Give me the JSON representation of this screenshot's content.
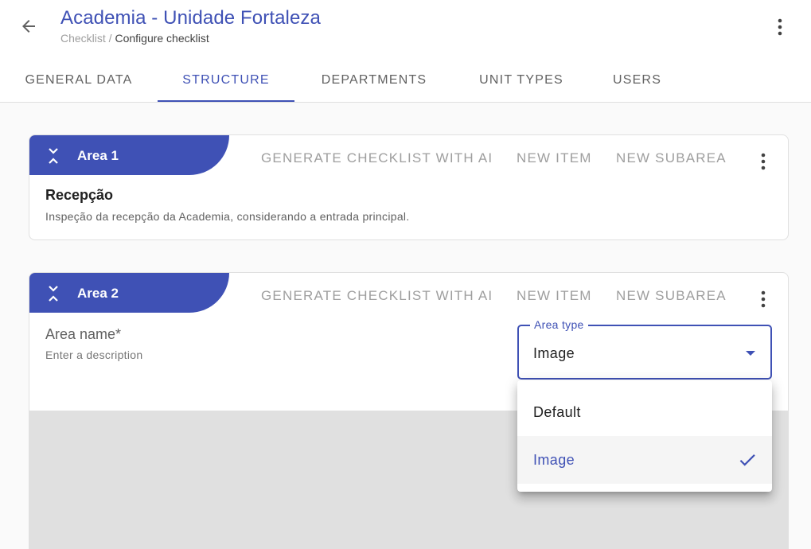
{
  "header": {
    "title": "Academia - Unidade Fortaleza",
    "breadcrumb_parent": "Checklist",
    "breadcrumb_separator": " / ",
    "breadcrumb_current": "Configure checklist",
    "back_icon": "arrow-left-icon",
    "menu_icon": "more-vert-icon"
  },
  "tabs": [
    {
      "label": "GENERAL DATA",
      "active": false
    },
    {
      "label": "STRUCTURE",
      "active": true
    },
    {
      "label": "DEPARTMENTS",
      "active": false
    },
    {
      "label": "UNIT TYPES",
      "active": false
    },
    {
      "label": "USERS",
      "active": false
    }
  ],
  "areas": [
    {
      "badge": "Area 1",
      "actions": {
        "generate": "GENERATE CHECKLIST WITH AI",
        "new_item": "NEW ITEM",
        "new_subarea": "NEW SUBAREA"
      },
      "name": "Recepção",
      "description": "Inspeção da recepção da Academia, considerando a entrada principal."
    },
    {
      "badge": "Area 2",
      "actions": {
        "generate": "GENERATE CHECKLIST WITH AI",
        "new_item": "NEW ITEM",
        "new_subarea": "NEW SUBAREA"
      },
      "name_placeholder": "Area name*",
      "description_placeholder": "Enter a description",
      "area_type": {
        "label": "Area type",
        "value": "Image",
        "options": [
          {
            "label": "Default",
            "selected": false
          },
          {
            "label": "Image",
            "selected": true
          }
        ]
      }
    }
  ],
  "colors": {
    "primary": "#3f51b5",
    "muted_action": "#9e9e9e",
    "background": "#fafafa"
  }
}
